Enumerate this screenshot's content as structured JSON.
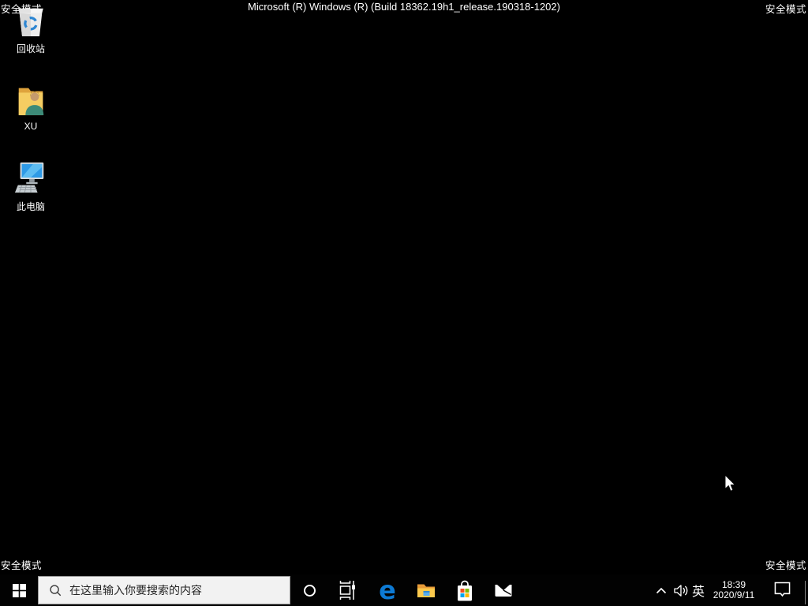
{
  "system": {
    "safe_mode_label": "安全模式",
    "build_banner": "Microsoft (R) Windows (R) (Build 18362.19h1_release.190318-1202)"
  },
  "desktop": {
    "icons": [
      {
        "name": "recycle-bin",
        "label": "回收站"
      },
      {
        "name": "user-folder-xu",
        "label": "XU"
      },
      {
        "name": "this-pc",
        "label": "此电脑"
      }
    ]
  },
  "taskbar": {
    "search": {
      "placeholder": "在这里输入你要搜索的内容",
      "icon": "search-icon"
    },
    "apps": [
      {
        "name": "start",
        "icon": "windows-logo-icon"
      },
      {
        "name": "cortana",
        "icon": "cortana-circle-icon"
      },
      {
        "name": "task-view",
        "icon": "task-view-icon"
      },
      {
        "name": "edge",
        "icon": "edge-e-icon"
      },
      {
        "name": "file-explorer",
        "icon": "folder-icon"
      },
      {
        "name": "microsoft-store",
        "icon": "store-bag-icon"
      },
      {
        "name": "mail",
        "icon": "envelope-icon"
      }
    ],
    "tray": {
      "hidden_icons": {
        "icon": "chevron-up-icon"
      },
      "volume": {
        "icon": "speaker-icon"
      },
      "ime_indicator": "英",
      "time": "18:39",
      "date": "2020/9/11",
      "action_center": {
        "icon": "notification-bubble-icon"
      }
    }
  },
  "colors": {
    "desktop_bg": "#000000",
    "taskbar_bg": "#020202",
    "searchbox_bg": "#f2f2f2",
    "searchbox_text": "#1f1f1f",
    "corner_text": "#ffffff",
    "edge_blue": "#0d7ad4",
    "folder_yellow": "#fcca4d",
    "store_red": "#f25022",
    "store_green": "#7fba00",
    "store_blue": "#00a4ef",
    "store_yellow": "#ffb900"
  }
}
